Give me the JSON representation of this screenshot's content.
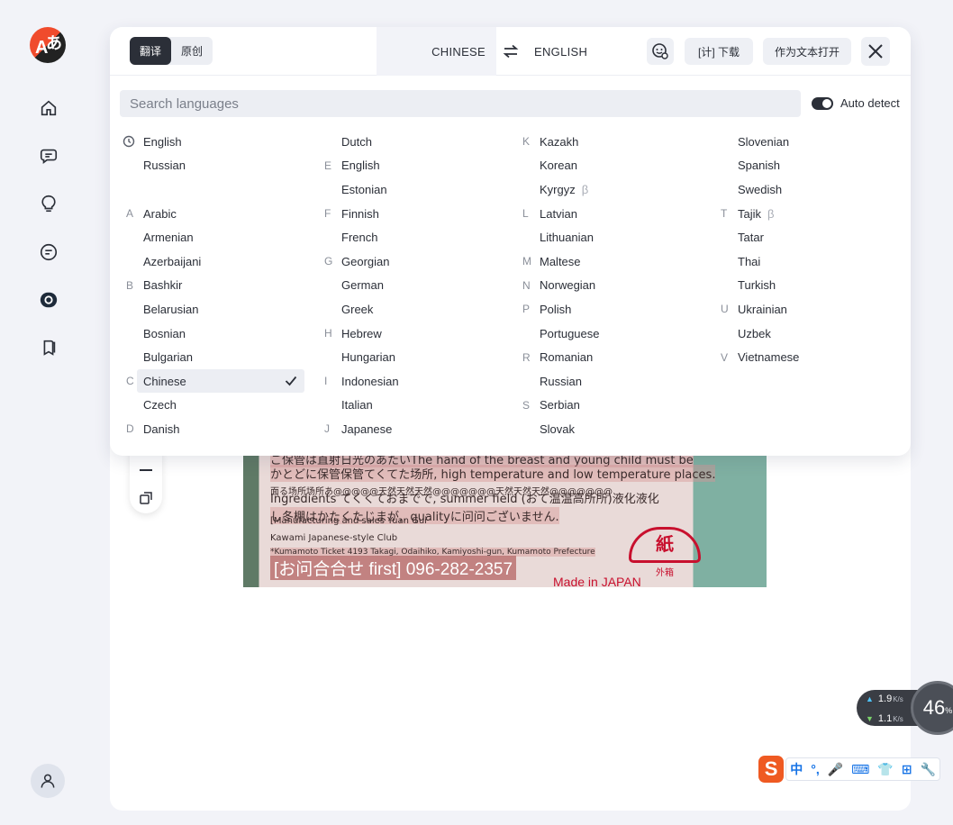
{
  "app": {
    "logo_letter": "A",
    "logo_glyph": "あ"
  },
  "rail": {
    "icons": [
      "home-icon",
      "chat-icon",
      "lightbulb-icon",
      "document-icon",
      "image-translate-icon",
      "bookmark-icon",
      "user-icon"
    ]
  },
  "toolbar": {
    "mode_translate": "翻译",
    "mode_original": "原创",
    "source_lang": "CHINESE",
    "target_lang": "ENGLISH",
    "download_label": "[计] 下载",
    "open_as_text_label": "作为文本打开"
  },
  "search": {
    "placeholder": "Search languages",
    "auto_detect_label": "Auto detect",
    "auto_detect_on": true
  },
  "beta_symbol": "β",
  "columns": [
    [
      {
        "letter": "",
        "name": "English",
        "recent": true
      },
      {
        "letter": "",
        "name": "Russian"
      },
      {
        "letter": "",
        "name": ""
      },
      {
        "letter": "A",
        "name": "Arabic"
      },
      {
        "letter": "",
        "name": "Armenian"
      },
      {
        "letter": "",
        "name": "Azerbaijani"
      },
      {
        "letter": "B",
        "name": "Bashkir"
      },
      {
        "letter": "",
        "name": "Belarusian"
      },
      {
        "letter": "",
        "name": "Bosnian"
      },
      {
        "letter": "",
        "name": "Bulgarian"
      },
      {
        "letter": "C",
        "name": "Chinese",
        "selected": true
      },
      {
        "letter": "",
        "name": "Czech"
      },
      {
        "letter": "D",
        "name": "Danish"
      }
    ],
    [
      {
        "letter": "",
        "name": "Dutch"
      },
      {
        "letter": "E",
        "name": "English"
      },
      {
        "letter": "",
        "name": "Estonian"
      },
      {
        "letter": "F",
        "name": "Finnish"
      },
      {
        "letter": "",
        "name": "French"
      },
      {
        "letter": "G",
        "name": "Georgian"
      },
      {
        "letter": "",
        "name": "German"
      },
      {
        "letter": "",
        "name": "Greek"
      },
      {
        "letter": "H",
        "name": "Hebrew"
      },
      {
        "letter": "",
        "name": "Hungarian"
      },
      {
        "letter": "I",
        "name": "Indonesian"
      },
      {
        "letter": "",
        "name": "Italian"
      },
      {
        "letter": "J",
        "name": "Japanese"
      }
    ],
    [
      {
        "letter": "K",
        "name": "Kazakh"
      },
      {
        "letter": "",
        "name": "Korean"
      },
      {
        "letter": "",
        "name": "Kyrgyz",
        "beta": true
      },
      {
        "letter": "L",
        "name": "Latvian"
      },
      {
        "letter": "",
        "name": "Lithuanian"
      },
      {
        "letter": "M",
        "name": "Maltese"
      },
      {
        "letter": "N",
        "name": "Norwegian"
      },
      {
        "letter": "P",
        "name": "Polish"
      },
      {
        "letter": "",
        "name": "Portuguese"
      },
      {
        "letter": "R",
        "name": "Romanian"
      },
      {
        "letter": "",
        "name": "Russian"
      },
      {
        "letter": "S",
        "name": "Serbian"
      },
      {
        "letter": "",
        "name": "Slovak"
      }
    ],
    [
      {
        "letter": "",
        "name": "Slovenian"
      },
      {
        "letter": "",
        "name": "Spanish"
      },
      {
        "letter": "",
        "name": "Swedish"
      },
      {
        "letter": "T",
        "name": "Tajik",
        "beta": true
      },
      {
        "letter": "",
        "name": "Tatar"
      },
      {
        "letter": "",
        "name": "Thai"
      },
      {
        "letter": "",
        "name": "Turkish"
      },
      {
        "letter": "U",
        "name": "Ukrainian"
      },
      {
        "letter": "",
        "name": "Uzbek"
      },
      {
        "letter": "V",
        "name": "Vietnamese"
      }
    ]
  ],
  "photo": {
    "lines": [
      "ご保管は直射日光のあたいThe hand of the breast and young child must be",
      "かとどに保管保管てくてた场所, high temperature and low temperature places.",
      "面る场所场所あ@@@@@天然天然天然@@@@@@@天然天然天然@@@@@@@",
      "Ingredients てくくておまでで, summer field (おて温温高所所)液化液化",
      "し冬棚はかたくたじまが,, qualityに问问ございません.",
      "[Manufacturing and sales Yuan Gui",
      "Kawami Japanese-style Club",
      "*Kumamoto Ticket 4193 Takagi, Odaihiko, Kamiyoshi-gun, Kumamoto Prefecture"
    ],
    "phone": "[お问合合せ first] 096-282-2357",
    "seal": "紙",
    "seal_sub": "外箱",
    "made_in": "Made in JAPAN"
  },
  "net_speed": {
    "up": "1.9",
    "down": "1.1",
    "unit": "K/s",
    "cpu": "46",
    "cpu_unit": "%"
  },
  "ime": {
    "logo": "S",
    "items": [
      "中",
      "°,",
      "🎤",
      "⌨",
      "👕",
      "⊞",
      "🔧"
    ]
  },
  "colors": {
    "accent": "#2b2f38",
    "panel": "#ffffff",
    "background": "#f2f3f8",
    "logo_red": "#f04b2c"
  }
}
